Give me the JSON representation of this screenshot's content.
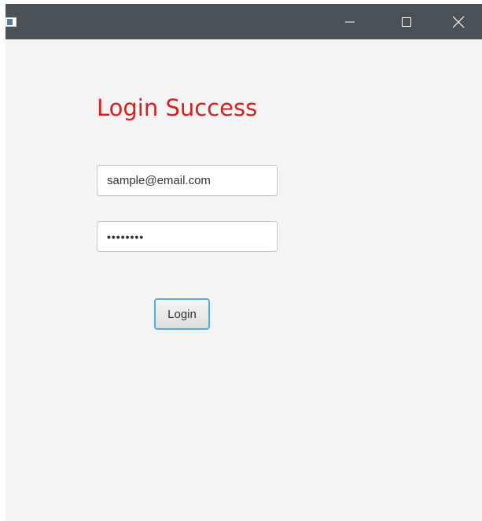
{
  "window": {
    "icon": "app-window-icon",
    "controls": [
      "minimize-icon",
      "maximize-icon",
      "close-icon"
    ]
  },
  "form": {
    "status_title": "Login Success",
    "status_color": "#d32222",
    "email_value": "sample@email.com",
    "password_value": "••••••••",
    "login_label": "Login"
  }
}
